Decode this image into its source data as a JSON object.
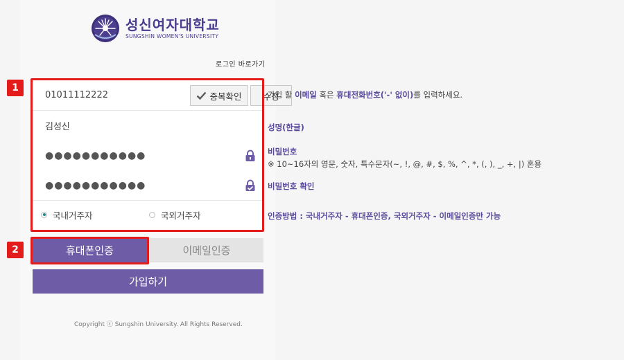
{
  "logo": {
    "name_kr": "성신여자대학교",
    "name_en": "SUNGSHIN WOMEN'S UNIVERSITY"
  },
  "shortcut": {
    "label": "로그인 바로가기"
  },
  "form": {
    "phone_value": "01011112222",
    "dup_check_label": "중복확인",
    "edit_label": "수정",
    "name_value": "김성신",
    "password_masked": "●●●●●●●●●●●",
    "password_confirm_masked": "●●●●●●●●●●●",
    "residence": {
      "options": [
        "국내거주자",
        "국외거주자"
      ],
      "selected": "국내거주자"
    }
  },
  "tabs": {
    "phone_label": "휴대폰인증",
    "email_label": "이메일인증",
    "active": "휴대폰인증"
  },
  "join_button": {
    "label": "가입하기"
  },
  "copyright": "Copyright ⓒ Sungshin University. All Rights Reserved.",
  "guide": {
    "id_pre": "가입 할 ",
    "id_b1": "이메일",
    "id_mid": " 혹은 ",
    "id_b2": "휴대전화번호('-' 없이)",
    "id_post": "를 입력하세요.",
    "name_title": "성명(한글)",
    "password_title": "비밀번호",
    "password_rule": "※ 10~16자의 영문, 숫자, 특수문자(~, !, @, #, $, %, ^, *, (, ), _, +, |) 혼용",
    "password_confirm_title": "비밀번호 확인",
    "auth_note": "인증방법 : 국내거주자 - 휴대폰인증, 국외거주자 - 이메일인증만 가능"
  },
  "annotations": {
    "badge_1": "1",
    "badge_2": "2"
  },
  "colors": {
    "brand_purple": "#6f5ca7",
    "guide_purple": "#5b4a9c",
    "highlight_red": "#e31b1b",
    "radio_teal": "#1a8c8c"
  }
}
